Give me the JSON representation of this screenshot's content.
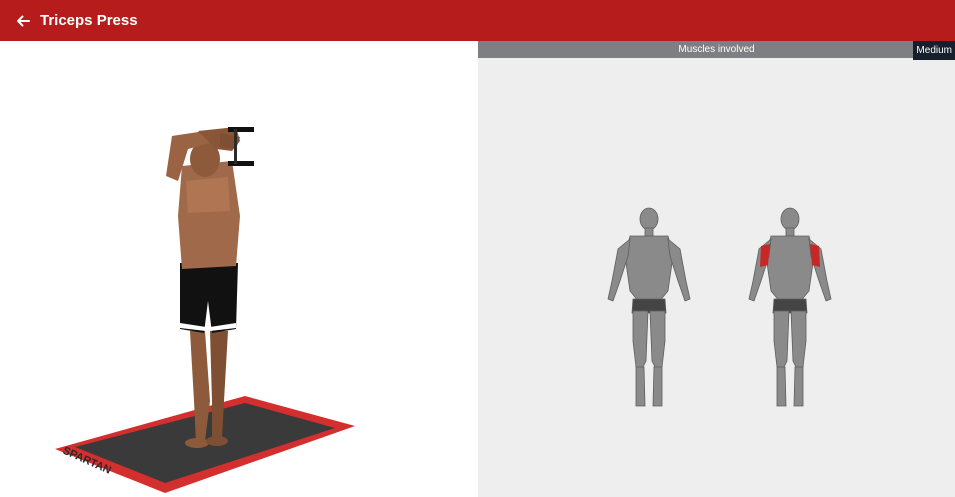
{
  "header": {
    "title": "Triceps Press",
    "back_icon": "arrow-left-icon",
    "color": "#b71c1c"
  },
  "exercise": {
    "mat_brand": "SPARTAN"
  },
  "muscles_panel": {
    "bar_label": "Muscles involved",
    "difficulty": "Medium",
    "highlight_color": "#c62828"
  }
}
